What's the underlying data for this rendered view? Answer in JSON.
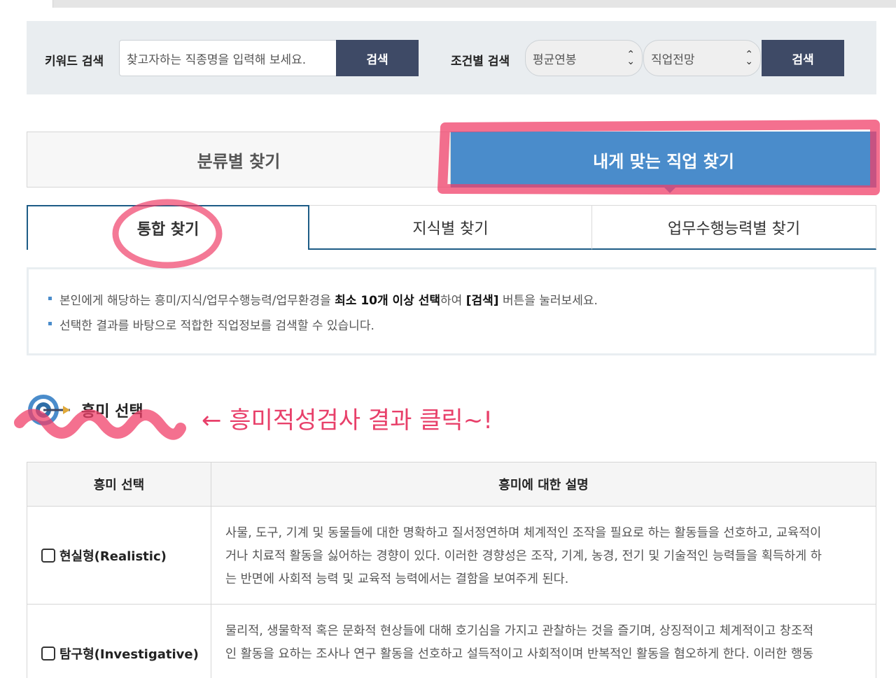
{
  "keyword_search": {
    "label": "키워드 검색",
    "placeholder": "찾고자하는 직종명을 입력해 보세요.",
    "button": "검색"
  },
  "condition_search": {
    "label": "조건별 검색",
    "salary_select": "평균연봉",
    "outlook_select": "직업전망",
    "button": "검색"
  },
  "main_tabs": {
    "by_category": "분류별 찾기",
    "find_my_job": "내게 맞는 직업 찾기"
  },
  "sub_tabs": [
    "통합 찾기",
    "지식별 찾기",
    "업무수행능력별 찾기"
  ],
  "info": {
    "line1_pre": "본인에게 해당하는 흥미/지식/업무수행능력/업무환경을 ",
    "line1_bold1": "최소 10개 이상 선택",
    "line1_mid": "하여 ",
    "line1_bold2": "[검색]",
    "line1_post": " 버튼을 눌러보세요.",
    "line2": "선택한 결과를 바탕으로 적합한 직업정보를 검색할 수 있습니다."
  },
  "section_title": "흥미 선택",
  "annotation_text": "← 흥미적성검사 결과 클릭~!",
  "table": {
    "headers": [
      "흥미 선택",
      "흥미에 대한 설명"
    ],
    "rows": [
      {
        "label": "현실형(Realistic)",
        "lines": [
          "사물, 도구, 기계 및 동물들에 대한 명확하고 질서정연하며 체계적인 조작을 필요로 하는 활동들을 선호하고, 교육적이",
          "거나 치료적 활동을 싫어하는 경향이 있다. 이러한 경향성은 조작, 기계, 농경, 전기 및 기술적인 능력들을 획득하게 하",
          "는 반면에 사회적 능력 및 교육적 능력에서는 결함을 보여주게 된다."
        ]
      },
      {
        "label": "탐구형(Investigative)",
        "lines": [
          "물리적, 생물학적 혹은 문화적 현상들에 대해 호기심을 가지고 관찰하는 것을 즐기며, 상징적이고 체계적이고 창조적",
          "인 활동을 요하는 조사나 연구 활동을 선호하고 설득적이고 사회적이며 반복적인 활동을 혐오하게 한다. 이러한 행동"
        ]
      }
    ]
  },
  "colors": {
    "navy": "#3e4a66",
    "active_tab_blue": "#4a8ccb",
    "subtab_border": "#1d5c86",
    "highlight_pink": "#f0406a"
  }
}
